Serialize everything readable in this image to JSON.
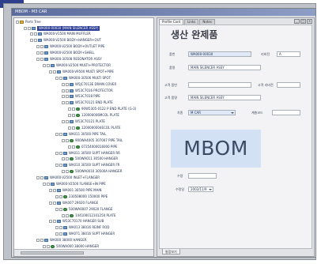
{
  "window": {
    "title": "MBOM - M3 CAR",
    "controls": [
      "_",
      "□",
      "×"
    ]
  },
  "tree": {
    "root": "Parts Tree",
    "nodes": [
      {
        "label": "WA000-00030 (MAIN SILENCER ASSY)",
        "icon": "part-folder-icon",
        "selected": true
      },
      {
        "label": "WA000-V1500 MAIN MUFFLER",
        "icon": "part-folder-icon"
      },
      {
        "label": "WA000-V2500 BODY+HANGER+OUT",
        "icon": "part-folder-icon"
      },
      {
        "label": "WA000-V2500 BODY+OUTLET PIPE",
        "icon": "part-folder-icon"
      },
      {
        "label": "WA000-V2500 BODY+SHELL",
        "icon": "part-folder-icon"
      },
      {
        "label": "WA000-30508 RESONATOR ASSY",
        "icon": "part-folder-icon"
      },
      {
        "label": "WA000-V2500 MULTI+PROTECTOR",
        "icon": "part-folder-icon"
      },
      {
        "label": "WA000-V9500 MULTI SPOT+PIPE",
        "icon": "part-folder-icon"
      },
      {
        "label": "WA000-30506 MULTI SPOT",
        "icon": "part-folder-icon"
      },
      {
        "label": "W5JC7013E DRAIN COVER",
        "icon": "part-icon"
      },
      {
        "label": "W53C7016 PROTECTOR",
        "icon": "part-icon"
      },
      {
        "label": "W53C7018 PIPE",
        "icon": "part-icon"
      },
      {
        "label": "W53C70121 END PLATE",
        "icon": "part-icon"
      },
      {
        "label": "90W5305-0122 P END PLATE (G-3)",
        "icon": "green-part-icon"
      },
      {
        "label": "120000006MCOL PLATE",
        "icon": "green-part-icon"
      },
      {
        "label": "W53C70121 PLATE",
        "icon": "part-icon"
      },
      {
        "label": "1200000004ECOL PLATE",
        "icon": "green-part-icon"
      },
      {
        "label": "WA011 30500 PIPE TAIL",
        "icon": "part-folder-icon"
      },
      {
        "label": "900WA4005 307007 PIPE TAIL",
        "icon": "green-part-icon"
      },
      {
        "label": "07254000016000 PIPE",
        "icon": "green-part-icon"
      },
      {
        "label": "WA011 30500 SUPT HANGER RR",
        "icon": "part-folder-icon"
      },
      {
        "label": "500WA011 30500 HANGER",
        "icon": "green-part-icon"
      },
      {
        "label": "WA010 30500 SUPT HANGER FR",
        "icon": "part-folder-icon"
      },
      {
        "label": "500WA0010 30500A HANGER",
        "icon": "green-part-icon"
      },
      {
        "label": "WA000-V2500 INLET+FLANGER",
        "icon": "part-folder-icon"
      },
      {
        "label": "WA000-V2500 FLANGE+IN PIPE",
        "icon": "part-folder-icon"
      },
      {
        "label": "WA001 30500 PIPE MAIN",
        "icon": "part-folder-icon"
      },
      {
        "label": "230508000 150000 PIPE",
        "icon": "green-part-icon"
      },
      {
        "label": "WA007 29020 FLANGE",
        "icon": "part-folder-icon"
      },
      {
        "label": "500WA0007 29020 FLANGE",
        "icon": "green-part-icon"
      },
      {
        "label": "144100012101250 PLATE",
        "icon": "green-part-icon"
      },
      {
        "label": "W53C70170 HANGER SUB",
        "icon": "part-folder-icon"
      },
      {
        "label": "WA013 38016 REINF ROD",
        "icon": "part-folder-icon"
      },
      {
        "label": "WA071 38016 SUPT HANGER",
        "icon": "part-folder-icon"
      },
      {
        "label": "WA000 38000 HANGER",
        "icon": "part-folder-icon"
      },
      {
        "label": "500WA000 38000 HANGER",
        "icon": "green-part-icon"
      }
    ]
  },
  "tabs": [
    "Profile Card",
    "Links",
    "Notes"
  ],
  "form": {
    "title": "생산 완제품",
    "labels": {
      "part_no": "품번",
      "revision": "리비전",
      "part_name": "품명",
      "customer_part_no": "고객 품번",
      "customer_revision": "고객 리비전",
      "customer_part_name": "고객 품명",
      "model": "차종",
      "unit": "계층코드",
      "quantity": "수량",
      "date": "수정일"
    },
    "values": {
      "part_no": "WA000-00030",
      "revision": "A",
      "part_name": "MAIN SILENCER ASSY",
      "customer_part_no": "",
      "customer_revision": "",
      "customer_part_name": "MAIN SILENCER ASSY",
      "model": "M CAR",
      "unit": "",
      "quantity": "",
      "date": "2002/11/9"
    }
  },
  "overlay": {
    "text": "MBOM"
  },
  "status": {
    "tab_label": "통합보기"
  },
  "colors": {
    "selection": "#2c3f94",
    "overlay_bg": "#d2e2f4",
    "title_gradient_start": "#5a6b9c"
  }
}
